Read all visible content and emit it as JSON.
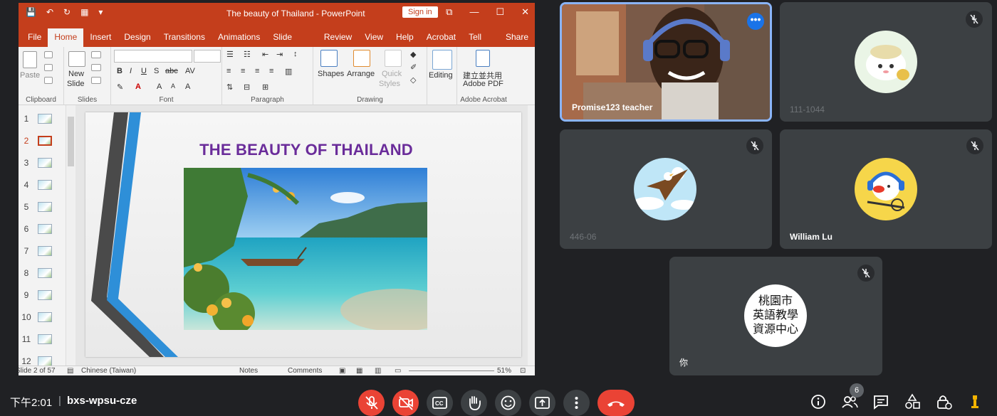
{
  "ppt": {
    "doc_title": "The beauty of  Thailand  -  PowerPoint",
    "sign_in": "Sign in",
    "tabs": [
      "File",
      "Home",
      "Insert",
      "Design",
      "Transitions",
      "Animations",
      "Slide Show",
      "Review",
      "View",
      "Help",
      "Acrobat",
      "Tell me",
      "Share"
    ],
    "active_tab": "Home",
    "ribbon": {
      "paste": "Paste",
      "clipboard": "Clipboard",
      "new_slide_1": "New",
      "new_slide_2": "Slide",
      "slides": "Slides",
      "font": "Font",
      "paragraph": "Paragraph",
      "shapes": "Shapes",
      "arrange": "Arrange",
      "quick_styles_1": "Quick",
      "quick_styles_2": "Styles",
      "drawing": "Drawing",
      "editing": "Editing",
      "adobe_1": "建立並共用",
      "adobe_2": "Adobe PDF",
      "adobe_acrobat": "Adobe Acrobat"
    },
    "thumbnails": [
      "1",
      "2",
      "3",
      "4",
      "5",
      "6",
      "7",
      "8",
      "9",
      "10",
      "11",
      "12"
    ],
    "active_slide_index": 1,
    "slide_title": "THE BEAUTY OF THAILAND",
    "status": {
      "slide_info": "Slide 2 of 57",
      "language": "Chinese (Taiwan)",
      "notes": "Notes",
      "comments": "Comments",
      "zoom": "51%"
    }
  },
  "participants": [
    {
      "name": "Promise123 teacher",
      "speaking": true,
      "muted": false
    },
    {
      "name": "111-1044",
      "speaking": false,
      "muted": true
    },
    {
      "name": "446-06",
      "speaking": false,
      "muted": true
    },
    {
      "name": "William Lu",
      "speaking": false,
      "muted": true
    },
    {
      "name": "你",
      "speaking": false,
      "muted": true,
      "avatar_text": [
        "桃園市",
        "英語教學",
        "資源中心"
      ]
    }
  ],
  "bottom_bar": {
    "time": "下午2:01",
    "separator": "|",
    "meeting_code": "bxs-wpsu-cze",
    "people_count": "6"
  },
  "colors": {
    "ppt_brand": "#c43e1c",
    "meet_bg": "#202124",
    "tile_bg": "#3c4043",
    "speaking_border": "#8ab4f8",
    "end_call": "#ea4335",
    "slide_title": "#6a2c9a"
  }
}
